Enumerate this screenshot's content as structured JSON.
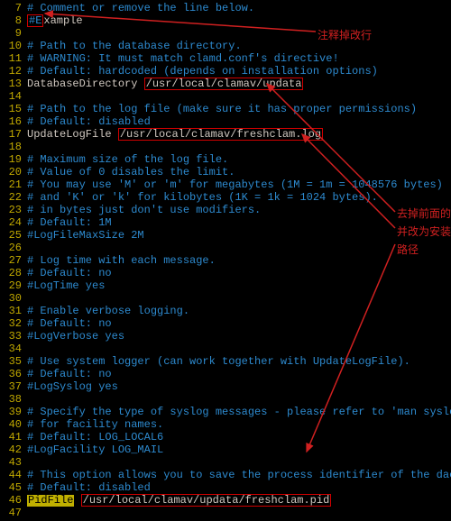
{
  "annotations": {
    "top": "注释掉改行",
    "side1": "去掉前面的#,",
    "side2": "并改为安装时的",
    "side3": "路径"
  },
  "lines": [
    {
      "n": "7",
      "t": "comment",
      "txt": "# Comment or remove the line below."
    },
    {
      "n": "8",
      "t": "boxed-hash",
      "pre": "",
      "box": "#E",
      "post": "xample"
    },
    {
      "n": "9",
      "t": "empty",
      "txt": ""
    },
    {
      "n": "10",
      "t": "comment",
      "txt": "# Path to the database directory."
    },
    {
      "n": "11",
      "t": "comment",
      "txt": "# WARNING: It must match clamd.conf's directive!"
    },
    {
      "n": "12",
      "t": "comment",
      "txt": "# Default: hardcoded (depends on installation options)"
    },
    {
      "n": "13",
      "t": "keyval",
      "k": "DatabaseDirectory ",
      "v": "/usr/local/clamav/updata"
    },
    {
      "n": "14",
      "t": "empty",
      "txt": ""
    },
    {
      "n": "15",
      "t": "comment",
      "txt": "# Path to the log file (make sure it has proper permissions)"
    },
    {
      "n": "16",
      "t": "comment",
      "txt": "# Default: disabled"
    },
    {
      "n": "17",
      "t": "keyval",
      "k": "UpdateLogFile ",
      "v": "/usr/local/clamav/freshclam.log"
    },
    {
      "n": "18",
      "t": "empty",
      "txt": ""
    },
    {
      "n": "19",
      "t": "comment",
      "txt": "# Maximum size of the log file."
    },
    {
      "n": "20",
      "t": "comment",
      "txt": "# Value of 0 disables the limit."
    },
    {
      "n": "21",
      "t": "comment",
      "txt": "# You may use 'M' or 'm' for megabytes (1M = 1m = 1048576 bytes)"
    },
    {
      "n": "22",
      "t": "comment",
      "txt": "# and 'K' or 'k' for kilobytes (1K = 1k = 1024 bytes)."
    },
    {
      "n": "23",
      "t": "comment",
      "txt": "# in bytes just don't use modifiers."
    },
    {
      "n": "24",
      "t": "comment",
      "txt": "# Default: 1M"
    },
    {
      "n": "25",
      "t": "comment",
      "txt": "#LogFileMaxSize 2M"
    },
    {
      "n": "26",
      "t": "empty",
      "txt": ""
    },
    {
      "n": "27",
      "t": "comment",
      "txt": "# Log time with each message."
    },
    {
      "n": "28",
      "t": "comment",
      "txt": "# Default: no"
    },
    {
      "n": "29",
      "t": "comment",
      "txt": "#LogTime yes"
    },
    {
      "n": "30",
      "t": "empty",
      "txt": ""
    },
    {
      "n": "31",
      "t": "comment",
      "txt": "# Enable verbose logging."
    },
    {
      "n": "32",
      "t": "comment",
      "txt": "# Default: no"
    },
    {
      "n": "33",
      "t": "comment",
      "txt": "#LogVerbose yes"
    },
    {
      "n": "34",
      "t": "empty",
      "txt": ""
    },
    {
      "n": "35",
      "t": "comment",
      "txt": "# Use system logger (can work together with UpdateLogFile)."
    },
    {
      "n": "36",
      "t": "comment",
      "txt": "# Default: no"
    },
    {
      "n": "37",
      "t": "comment",
      "txt": "#LogSyslog yes"
    },
    {
      "n": "38",
      "t": "empty",
      "txt": ""
    },
    {
      "n": "39",
      "t": "comment",
      "txt": "# Specify the type of syslog messages - please refer to 'man syslog'"
    },
    {
      "n": "40",
      "t": "comment",
      "txt": "# for facility names."
    },
    {
      "n": "41",
      "t": "comment",
      "txt": "# Default: LOG_LOCAL6"
    },
    {
      "n": "42",
      "t": "comment",
      "txt": "#LogFacility LOG_MAIL"
    },
    {
      "n": "43",
      "t": "empty",
      "txt": ""
    },
    {
      "n": "44",
      "t": "comment",
      "txt": "# This option allows you to save the process identifier of the daemon"
    },
    {
      "n": "45",
      "t": "comment",
      "txt": "# Default: disabled"
    },
    {
      "n": "46",
      "t": "pidfile",
      "k": "PidFile",
      "v": "/usr/local/clamav/updata/freshclam.pid"
    },
    {
      "n": "47",
      "t": "empty",
      "txt": ""
    }
  ]
}
